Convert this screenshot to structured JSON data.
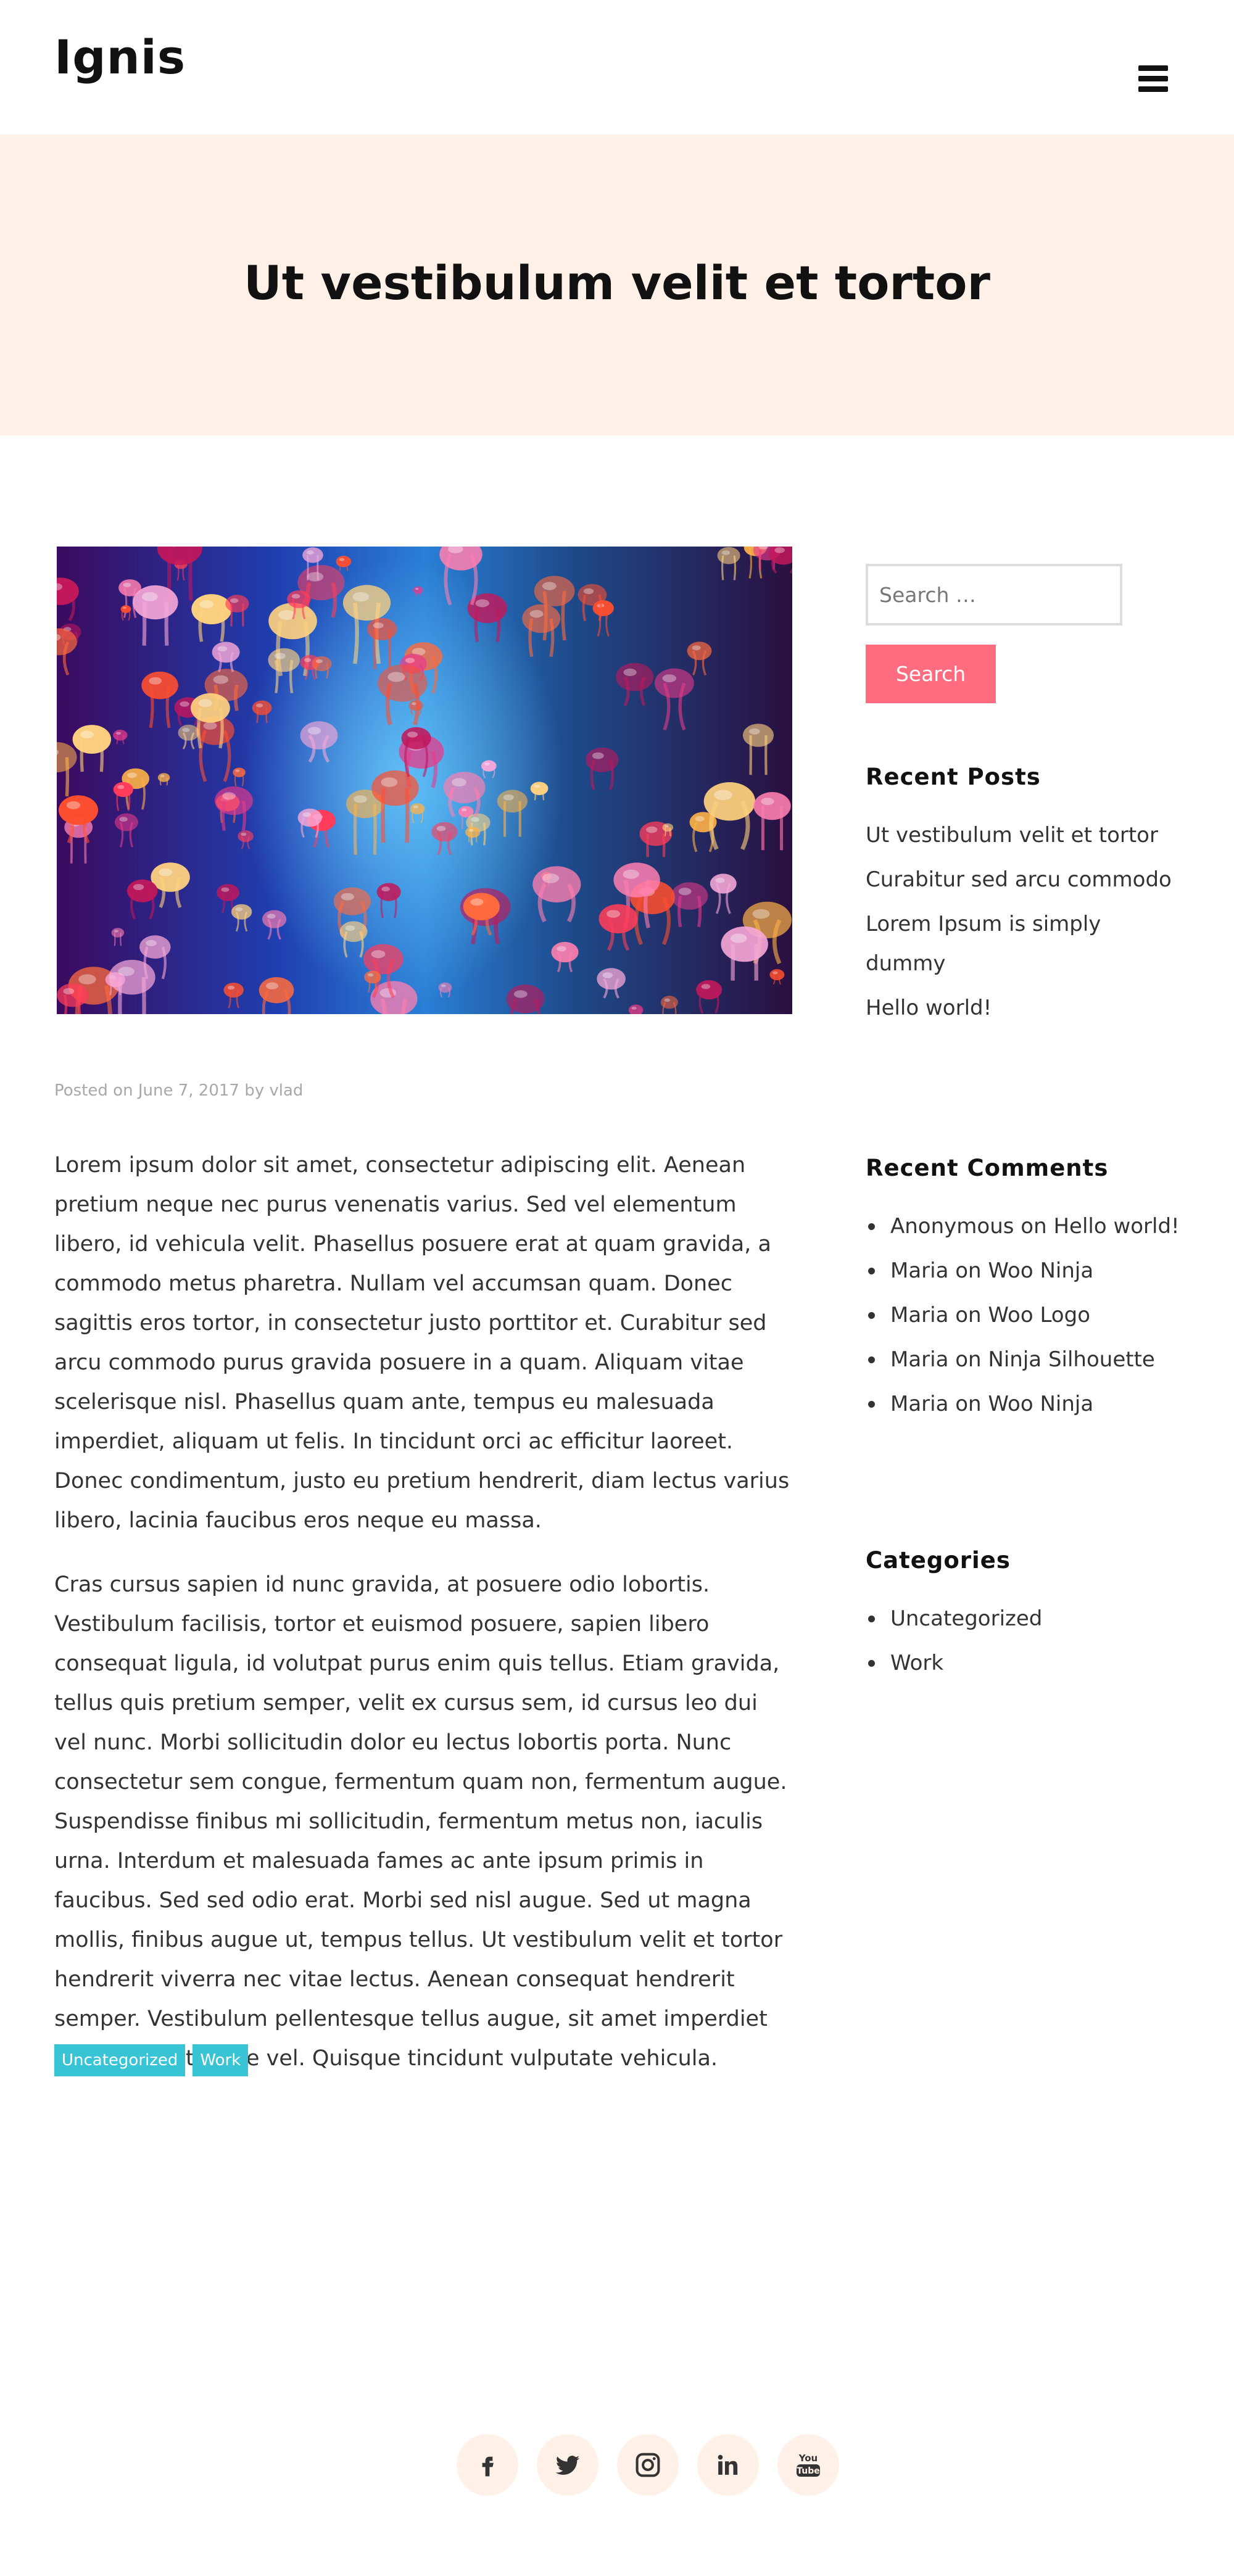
{
  "header": {
    "site_title": "Ignis",
    "menu_icon": "hamburger-menu-icon"
  },
  "hero": {
    "title": "Ut vestibulum velit et tortor"
  },
  "post": {
    "image_subject": "jellyfish aquarium photo",
    "meta": {
      "prefix": "Posted on",
      "date": "June 7, 2017",
      "by": "by",
      "author": "vlad"
    },
    "paragraphs": [
      "Lorem ipsum dolor sit amet, consectetur adipiscing elit. Aenean pretium neque nec purus venenatis varius. Sed vel elementum libero, id vehicula velit. Phasellus posuere erat at quam gravida, a commodo metus pharetra. Nullam vel accumsan quam. Donec sagittis eros tortor, in consectetur justo porttitor et. Curabitur sed arcu commodo purus gravida posuere in a quam. Aliquam vitae scelerisque nisl. Phasellus quam ante, tempus eu malesuada imperdiet, aliquam ut felis. In tincidunt orci ac efficitur laoreet. Donec condimentum, justo eu pretium hendrerit, diam lectus varius libero, lacinia faucibus eros neque eu massa.",
      "Cras cursus sapien id nunc gravida, at posuere odio lobortis. Vestibulum facilisis, tortor et euismod posuere, sapien libero consequat ligula, id volutpat purus enim quis tellus. Etiam gravida, tellus quis pretium semper, velit ex cursus sem, id cursus leo dui vel nunc. Morbi sollicitudin dolor eu lectus lobortis porta. Nunc consectetur sem congue, fermentum quam non, fermentum augue. Suspendisse finibus mi sollicitudin, fermentum metus non, iaculis urna. Interdum et malesuada fames ac ante ipsum primis in faucibus. Sed sed odio erat. Morbi sed nisl augue. Sed ut magna mollis, finibus augue ut, tempus tellus. Ut vestibulum velit et tortor hendrerit viverra nec vitae lectus. Aenean consequat hendrerit semper. Vestibulum pellentesque tellus augue, sit amet imperdiet ligula pellentesque vel. Quisque tincidunt vulputate vehicula."
    ],
    "tags": [
      "Uncategorized",
      "Work"
    ]
  },
  "sidebar": {
    "search": {
      "placeholder": "Search …",
      "button_label": "Search"
    },
    "recent_posts": {
      "title": "Recent Posts",
      "items": [
        "Ut vestibulum velit et tortor",
        "Curabitur sed arcu commodo",
        "Lorem Ipsum is simply dummy",
        "Hello world!"
      ]
    },
    "recent_comments": {
      "title": "Recent Comments",
      "on": "on",
      "items": [
        {
          "author": "Anonymous",
          "post": "Hello world!"
        },
        {
          "author": "Maria",
          "post": "Woo Ninja"
        },
        {
          "author": "Maria",
          "post": "Woo Logo"
        },
        {
          "author": "Maria",
          "post": "Ninja Silhouette"
        },
        {
          "author": "Maria",
          "post": "Woo Ninja"
        }
      ]
    },
    "categories": {
      "title": "Categories",
      "items": [
        "Uncategorized",
        "Work"
      ]
    }
  },
  "footer": {
    "social_icons": [
      "facebook-icon",
      "twitter-icon",
      "instagram-icon",
      "linkedin-icon",
      "youtube-icon"
    ],
    "youtube_label_top": "You",
    "youtube_label_bottom": "Tube"
  },
  "colors": {
    "hero_bg": "#fff0e8",
    "accent_button": "#ff6b7f",
    "tag_bg": "#38c4d4",
    "social_bg": "#fff0e8"
  }
}
